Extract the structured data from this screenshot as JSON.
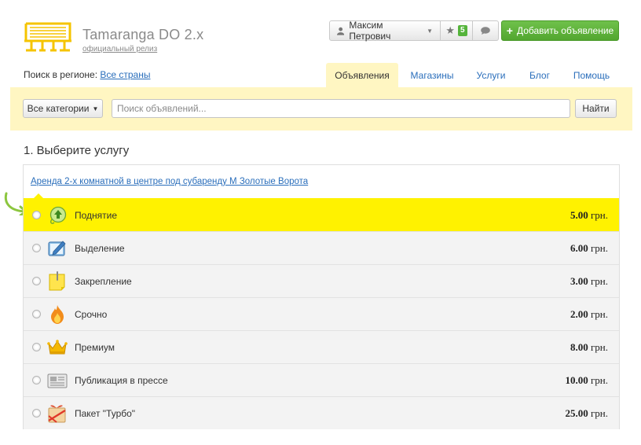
{
  "header": {
    "brand_title": "Tamaranga DO 2.x",
    "brand_subtitle": "официальный релиз",
    "user_name": "Максим Петрович",
    "favorites_count": "5",
    "add_button_label": "Добавить объявление",
    "accent_color": "#f5c400",
    "add_button_color": "#5ab53a"
  },
  "region": {
    "label": "Поиск в регионе:",
    "value": "Все страны"
  },
  "tabs": [
    {
      "label": "Объявления",
      "active": true
    },
    {
      "label": "Магазины",
      "active": false
    },
    {
      "label": "Услуги",
      "active": false
    },
    {
      "label": "Блог",
      "active": false
    },
    {
      "label": "Помощь",
      "active": false
    }
  ],
  "search": {
    "category_label": "Все категории",
    "placeholder": "Поиск объявлений...",
    "value": "",
    "button_label": "Найти"
  },
  "services": {
    "title": "1. Выберите услугу",
    "ad_link": "Аренда 2-х комнатной в центре под субаренду М Золотые Ворота",
    "currency": "грн.",
    "items": [
      {
        "name": "Поднятие",
        "price": "5.00",
        "icon": "up-arrow-icon",
        "selected": true
      },
      {
        "name": "Выделение",
        "price": "6.00",
        "icon": "pencil-icon",
        "selected": false
      },
      {
        "name": "Закрепление",
        "price": "3.00",
        "icon": "sticky-note-icon",
        "selected": false
      },
      {
        "name": "Срочно",
        "price": "2.00",
        "icon": "fire-icon",
        "selected": false
      },
      {
        "name": "Премиум",
        "price": "8.00",
        "icon": "crown-icon",
        "selected": false
      },
      {
        "name": "Публикация в прессе",
        "price": "10.00",
        "icon": "newspaper-icon",
        "selected": false
      },
      {
        "name": "Пакет \"Турбо\"",
        "price": "25.00",
        "icon": "turbo-package-icon",
        "selected": false
      }
    ],
    "highlight_color": "#fff200"
  }
}
